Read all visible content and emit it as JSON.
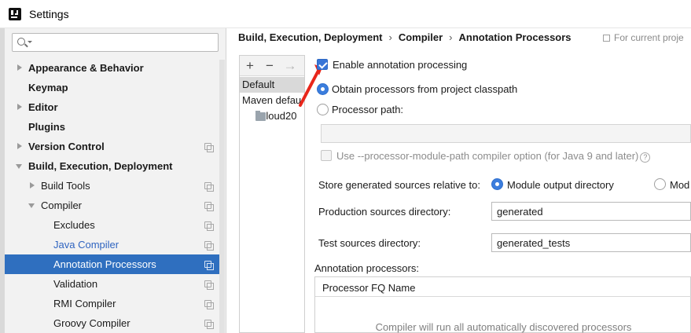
{
  "window": {
    "title": "Settings"
  },
  "search": {
    "placeholder": ""
  },
  "sidebar": {
    "items": [
      {
        "label": "Appearance & Behavior",
        "bold": true
      },
      {
        "label": "Keymap",
        "bold": true
      },
      {
        "label": "Editor",
        "bold": true
      },
      {
        "label": "Plugins",
        "bold": true
      },
      {
        "label": "Version Control",
        "bold": true
      },
      {
        "label": "Build, Execution, Deployment",
        "bold": true
      },
      {
        "label": "Build Tools"
      },
      {
        "label": "Compiler"
      },
      {
        "label": "Excludes"
      },
      {
        "label": "Java Compiler"
      },
      {
        "label": "Annotation Processors",
        "selected": true
      },
      {
        "label": "Validation"
      },
      {
        "label": "RMI Compiler"
      },
      {
        "label": "Groovy Compiler"
      }
    ]
  },
  "breadcrumb": {
    "parts": [
      "Build, Execution, Deployment",
      "Compiler",
      "Annotation Processors"
    ],
    "separator": "›"
  },
  "scope_note": "For current proje",
  "profiles": {
    "toolbar": {
      "add": "+",
      "remove": "−",
      "move": "→"
    },
    "items": [
      "Default",
      "Maven defau",
      "Cloud20"
    ]
  },
  "form": {
    "enable_label": "Enable annotation processing",
    "enable_checked": true,
    "obtain_label": "Obtain processors from project classpath",
    "path_label": "Processor path:",
    "path_value": "",
    "module_path_label": "Use --processor-module-path compiler option (for Java 9 and later)",
    "help_glyph": "?",
    "store_label": "Store generated sources relative to:",
    "store_opt1": "Module output directory",
    "store_opt2": "Mod",
    "prod_label": "Production sources directory:",
    "prod_value": "generated",
    "test_label": "Test sources directory:",
    "test_value": "generated_tests",
    "processors_label": "Annotation processors:",
    "table_header": "Processor FQ Name",
    "table_empty": "Compiler will run all automatically discovered processors"
  },
  "colors": {
    "selection": "#2f6fbf",
    "link": "#2f64c0",
    "accent": "#3875d7",
    "annotation_arrow": "#e8261b"
  }
}
